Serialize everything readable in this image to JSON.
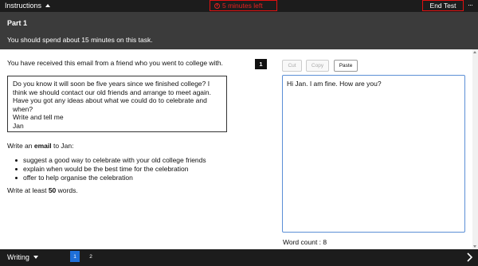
{
  "topbar": {
    "instructions_label": "Instructions",
    "timer_text": "5 minutes left",
    "end_test_label": "End Test",
    "more_label": "···"
  },
  "part": {
    "title": "Part 1",
    "description": "You should spend about 15 minutes on this task."
  },
  "prompt": {
    "intro": "You have received this email from a friend who you went to college with.",
    "email_lines": [
      "Do you know it will soon be five years since we finished college? I",
      "think we should contact our old friends and arrange to meet again.",
      "Have you got any ideas about what we could do to celebrate and",
      "when?",
      "Write and tell me",
      "Jan"
    ],
    "task_prefix": "Write an ",
    "task_bold": "email",
    "task_suffix": " to Jan:",
    "bullets": [
      "suggest a good way to celebrate with your old college friends",
      "explain when would be the best time for the celebration",
      "offer to help organise the celebration"
    ],
    "word_req_prefix": "Write at least ",
    "word_req_bold": "50",
    "word_req_suffix": " words."
  },
  "question": {
    "number": "1"
  },
  "editor": {
    "cut_label": "Cut",
    "copy_label": "Copy",
    "paste_label": "Paste",
    "answer_text": "Hi Jan. I am fine. How are you?",
    "word_count_text": "Word count : 8"
  },
  "footer": {
    "section_label": "Writing",
    "pages": [
      "1",
      "2"
    ],
    "current_page": "1"
  }
}
